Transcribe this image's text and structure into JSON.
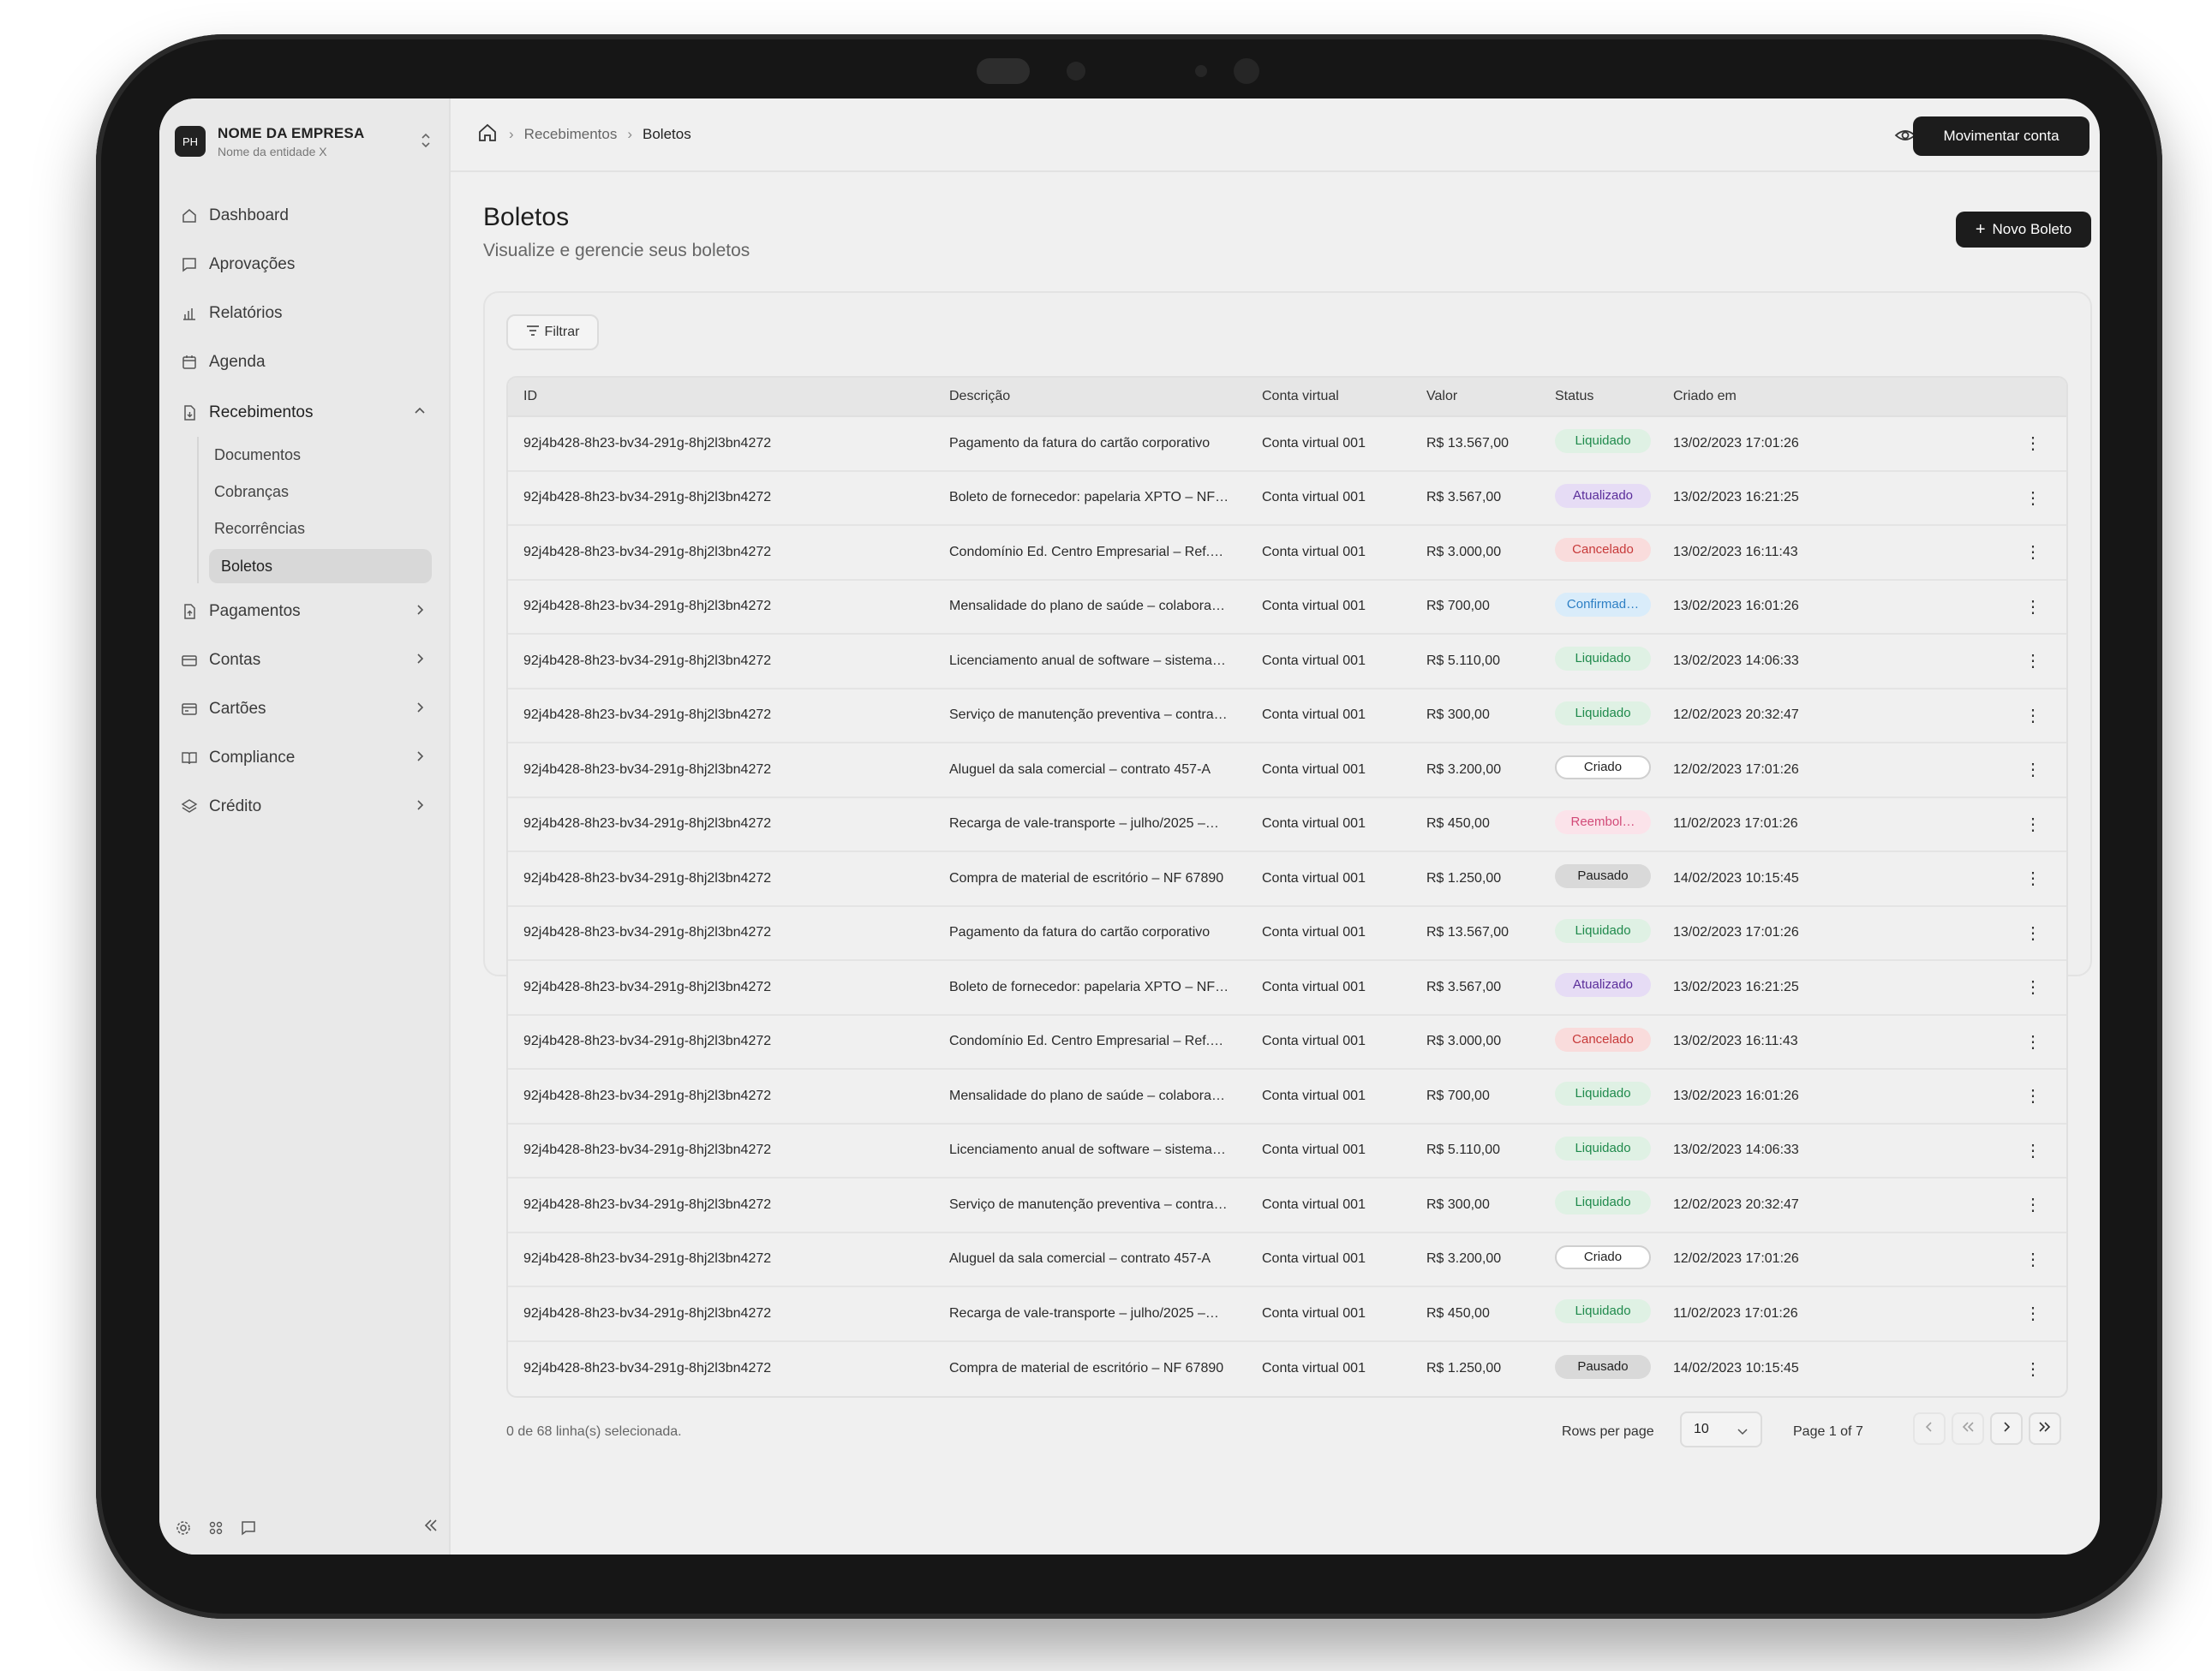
{
  "org": {
    "initials": "PH",
    "name": "NOME DA EMPRESA",
    "entity": "Nome da entidade X"
  },
  "nav": {
    "dashboard": "Dashboard",
    "aprovacoes": "Aprovações",
    "relatorios": "Relatórios",
    "agenda": "Agenda",
    "recebimentos": "Recebimentos",
    "sub": [
      "Documentos",
      "Cobranças",
      "Recorrências",
      "Boletos"
    ],
    "pagamentos": "Pagamentos",
    "contas": "Contas",
    "cartoes": "Cartões",
    "compliance": "Compliance",
    "credito": "Crédito"
  },
  "breadcrumb": [
    "Recebimentos",
    "Boletos"
  ],
  "header": {
    "action": "Movimentar conta"
  },
  "page": {
    "title": "Boletos",
    "subtitle": "Visualize e gerencie seus boletos",
    "new_button": "Novo Boleto",
    "filter": "Filtrar"
  },
  "table": {
    "columns": [
      "ID",
      "Descrição",
      "Conta virtual",
      "Valor",
      "Status",
      "Criado em"
    ],
    "rows": [
      {
        "id": "92j4b428-8h23-bv34-291g-8hj2l3bn4272",
        "desc": "Pagamento da fatura do cartão corporativo",
        "conta": "Conta virtual 001",
        "valor": "R$ 13.567,00",
        "status": "Liquidado",
        "data": "13/02/2023 17:01:26"
      },
      {
        "id": "92j4b428-8h23-bv34-291g-8hj2l3bn4272",
        "desc": "Boleto de fornecedor: papelaria XPTO – NF…",
        "conta": "Conta virtual 001",
        "valor": "R$ 3.567,00",
        "status": "Atualizado",
        "data": "13/02/2023 16:21:25"
      },
      {
        "id": "92j4b428-8h23-bv34-291g-8hj2l3bn4272",
        "desc": "Condomínio Ed. Centro Empresarial – Ref.…",
        "conta": "Conta virtual 001",
        "valor": "R$ 3.000,00",
        "status": "Cancelado",
        "data": "13/02/2023 16:11:43"
      },
      {
        "id": "92j4b428-8h23-bv34-291g-8hj2l3bn4272",
        "desc": "Mensalidade do plano de saúde – colabora…",
        "conta": "Conta virtual 001",
        "valor": "R$ 700,00",
        "status": "Confirmad…",
        "data": "13/02/2023 16:01:26"
      },
      {
        "id": "92j4b428-8h23-bv34-291g-8hj2l3bn4272",
        "desc": "Licenciamento anual de software – sistema…",
        "conta": "Conta virtual 001",
        "valor": "R$ 5.110,00",
        "status": "Liquidado",
        "data": "13/02/2023 14:06:33"
      },
      {
        "id": "92j4b428-8h23-bv34-291g-8hj2l3bn4272",
        "desc": "Serviço de manutenção preventiva – contra…",
        "conta": "Conta virtual 001",
        "valor": "R$ 300,00",
        "status": "Liquidado",
        "data": "12/02/2023 20:32:47"
      },
      {
        "id": "92j4b428-8h23-bv34-291g-8hj2l3bn4272",
        "desc": "Aluguel da sala comercial – contrato 457-A",
        "conta": "Conta virtual 001",
        "valor": "R$ 3.200,00",
        "status": "Criado",
        "data": "12/02/2023 17:01:26"
      },
      {
        "id": "92j4b428-8h23-bv34-291g-8hj2l3bn4272",
        "desc": "Recarga de vale-transporte – julho/2025 –…",
        "conta": "Conta virtual 001",
        "valor": "R$ 450,00",
        "status": "Reembol…",
        "data": "11/02/2023 17:01:26"
      },
      {
        "id": "92j4b428-8h23-bv34-291g-8hj2l3bn4272",
        "desc": "Compra de material de escritório – NF 67890",
        "conta": "Conta virtual 001",
        "valor": "R$ 1.250,00",
        "status": "Pausado",
        "data": "14/02/2023 10:15:45"
      },
      {
        "id": "92j4b428-8h23-bv34-291g-8hj2l3bn4272",
        "desc": "Pagamento da fatura do cartão corporativo",
        "conta": "Conta virtual 001",
        "valor": "R$ 13.567,00",
        "status": "Liquidado",
        "data": "13/02/2023 17:01:26"
      },
      {
        "id": "92j4b428-8h23-bv34-291g-8hj2l3bn4272",
        "desc": "Boleto de fornecedor: papelaria XPTO – NF…",
        "conta": "Conta virtual 001",
        "valor": "R$ 3.567,00",
        "status": "Atualizado",
        "data": "13/02/2023 16:21:25"
      },
      {
        "id": "92j4b428-8h23-bv34-291g-8hj2l3bn4272",
        "desc": "Condomínio Ed. Centro Empresarial – Ref.…",
        "conta": "Conta virtual 001",
        "valor": "R$ 3.000,00",
        "status": "Cancelado",
        "data": "13/02/2023 16:11:43"
      },
      {
        "id": "92j4b428-8h23-bv34-291g-8hj2l3bn4272",
        "desc": "Mensalidade do plano de saúde – colabora…",
        "conta": "Conta virtual 001",
        "valor": "R$ 700,00",
        "status": "Liquidado",
        "data": "13/02/2023 16:01:26"
      },
      {
        "id": "92j4b428-8h23-bv34-291g-8hj2l3bn4272",
        "desc": "Licenciamento anual de software – sistema…",
        "conta": "Conta virtual 001",
        "valor": "R$ 5.110,00",
        "status": "Liquidado",
        "data": "13/02/2023 14:06:33"
      },
      {
        "id": "92j4b428-8h23-bv34-291g-8hj2l3bn4272",
        "desc": "Serviço de manutenção preventiva – contra…",
        "conta": "Conta virtual 001",
        "valor": "R$ 300,00",
        "status": "Liquidado",
        "data": "12/02/2023 20:32:47"
      },
      {
        "id": "92j4b428-8h23-bv34-291g-8hj2l3bn4272",
        "desc": "Aluguel da sala comercial – contrato 457-A",
        "conta": "Conta virtual 001",
        "valor": "R$ 3.200,00",
        "status": "Criado",
        "data": "12/02/2023 17:01:26"
      },
      {
        "id": "92j4b428-8h23-bv34-291g-8hj2l3bn4272",
        "desc": "Recarga de vale-transporte – julho/2025 –…",
        "conta": "Conta virtual 001",
        "valor": "R$ 450,00",
        "status": "Liquidado",
        "data": "11/02/2023 17:01:26"
      },
      {
        "id": "92j4b428-8h23-bv34-291g-8hj2l3bn4272",
        "desc": "Compra de material de escritório – NF 67890",
        "conta": "Conta virtual 001",
        "valor": "R$ 1.250,00",
        "status": "Pausado",
        "data": "14/02/2023 10:15:45"
      }
    ]
  },
  "status_colors": {
    "Liquidado": {
      "bg": "#dff1e4",
      "fg": "#1f8a4c"
    },
    "Atualizado": {
      "bg": "#e6dcf5",
      "fg": "#5a2d9a"
    },
    "Cancelado": {
      "bg": "#f9dcdc",
      "fg": "#c73a3a"
    },
    "Confirmad…": {
      "bg": "#d9ecfa",
      "fg": "#2d7fc4"
    },
    "Criado": {
      "bg": "#ffffff",
      "fg": "#222222",
      "border": "#cfcfcf"
    },
    "Reembol…": {
      "bg": "#fbe3ea",
      "fg": "#d24a78"
    },
    "Pausado": {
      "bg": "#d9d9d9",
      "fg": "#222222"
    }
  },
  "footer": {
    "selected": "0 de 68 linha(s) selecionada.",
    "rows_per_page": "Rows per page",
    "page_size": "10",
    "page": "Page 1 of 7"
  }
}
